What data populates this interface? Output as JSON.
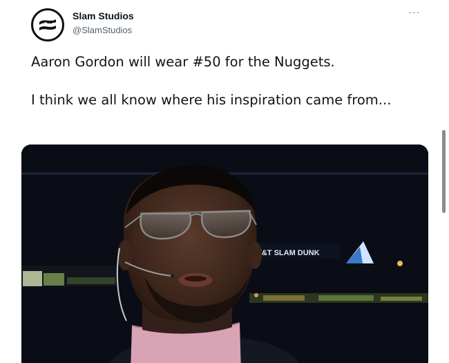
{
  "tweet": {
    "author": {
      "display_name": "Slam Studios",
      "handle": "@SlamStudios",
      "avatar_icon": "slam-logo-icon"
    },
    "more_icon": "ellipsis-icon",
    "more_label": "···",
    "text_lines": [
      "Aaron Gordon will wear #50 for the Nuggets.",
      "I think we all know where his inspiration came from..."
    ],
    "media": {
      "icon": "photo-icon",
      "arena_sign_text": "AT&T SLAM DUNK"
    }
  },
  "colors": {
    "text_primary": "#0f1419",
    "text_secondary": "#536471",
    "turtleneck": "#d9a3b6",
    "media_background": "#0b0e16"
  }
}
